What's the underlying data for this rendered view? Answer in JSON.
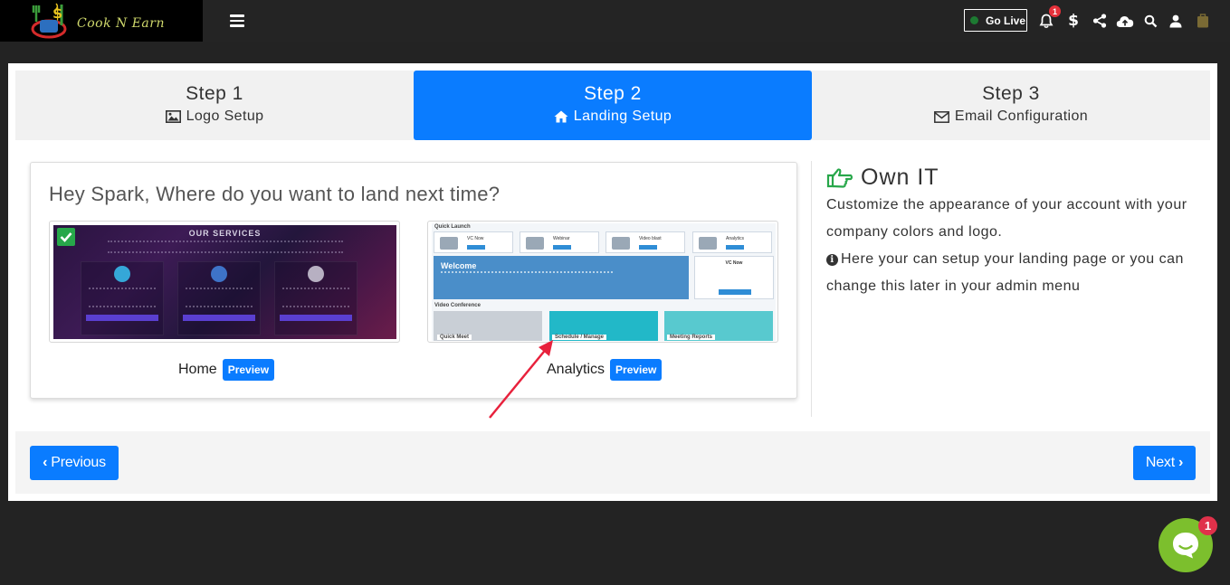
{
  "header": {
    "logo_text": "Cook N Earn",
    "go_live_label": "Go Live",
    "notification_count": "1",
    "icons": [
      "menu-icon",
      "bell-icon",
      "dollar-icon",
      "share-icon",
      "cloud-upload-icon",
      "search-icon",
      "user-icon",
      "shopping-bag-icon"
    ]
  },
  "steps": [
    {
      "number": "Step 1",
      "label": "Logo Setup",
      "icon": "image-icon",
      "active": false
    },
    {
      "number": "Step 2",
      "label": "Landing Setup",
      "icon": "home-icon",
      "active": true
    },
    {
      "number": "Step 3",
      "label": "Email Configuration",
      "icon": "envelope-icon",
      "active": false
    }
  ],
  "landing": {
    "question": "Hey Spark, Where do you want to land next time?",
    "options": [
      {
        "name": "Home",
        "preview_label": "Preview",
        "selected": true,
        "thumb_heading": "OUR SERVICES"
      },
      {
        "name": "Analytics",
        "preview_label": "Preview",
        "selected": false,
        "thumb_labels": {
          "quick_launch": "Quick Launch",
          "vc_now": "VC Now",
          "webinar": "Webinar",
          "video_blast": "Video blast",
          "analytics": "Analytics",
          "welcome": "Welcome",
          "video_conference": "Video Conference",
          "quick_meet": "Quick Meet",
          "schedule": "Schedule / Manage",
          "reports": "Meeting Reports"
        }
      }
    ]
  },
  "sidebar": {
    "title": "Own IT",
    "line1": "Customize the appearance of your account with your company colors and logo.",
    "line2": "Here your can setup your landing page or you can change this later in your admin menu"
  },
  "navigation": {
    "previous_label": "Previous",
    "next_label": "Next"
  },
  "chat": {
    "badge": "1"
  },
  "colors": {
    "primary": "#0a7cff",
    "success": "#27a74a",
    "chat": "#7cbf2d",
    "arrow": "#e8213c"
  }
}
